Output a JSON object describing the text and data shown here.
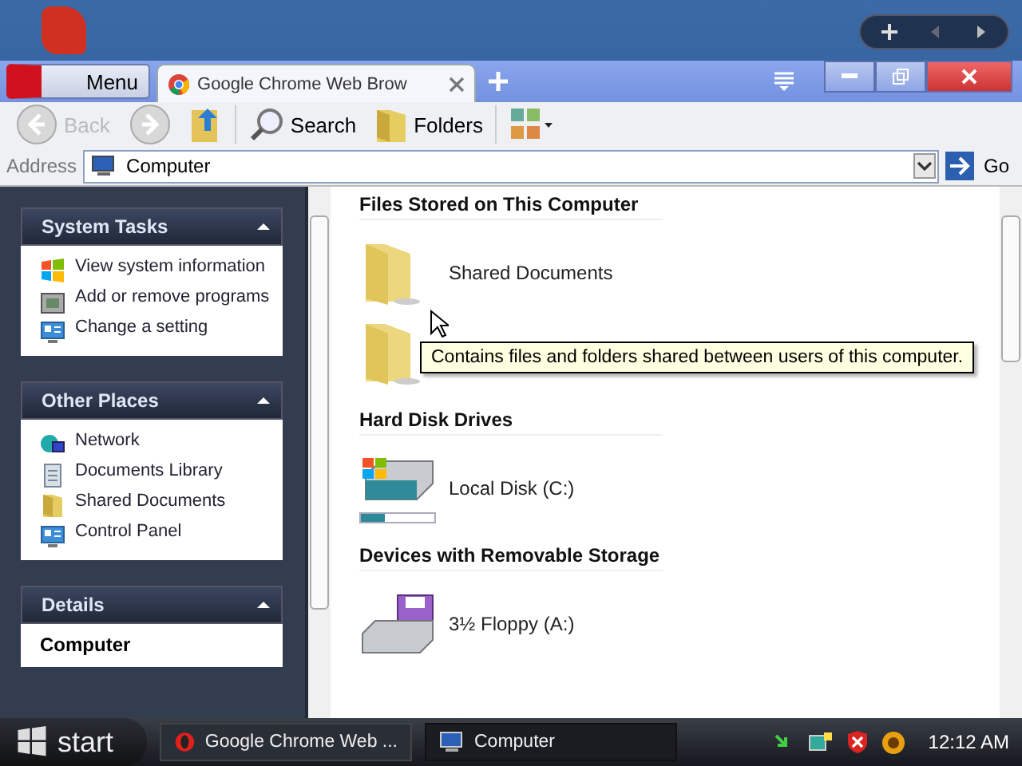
{
  "browser": {
    "menu_label": "Menu",
    "tabs": [
      {
        "label": "Google Chrome Web Brow",
        "selected": true
      }
    ]
  },
  "toolbar": {
    "buttons": [
      {
        "kind": "back",
        "label": "Back",
        "disabled": true
      },
      {
        "kind": "forward",
        "disabled": true
      },
      {
        "kind": "up"
      },
      {
        "kind": "search",
        "label": "Search"
      },
      {
        "kind": "folders",
        "label": "Folders"
      },
      {
        "kind": "views"
      }
    ]
  },
  "address": {
    "label": "Address",
    "value": "Computer",
    "go": "Go"
  },
  "sidebar": {
    "groups": [
      {
        "title": "System Tasks",
        "expanded": true,
        "items": [
          {
            "label": "View system information"
          },
          {
            "label": "Add or remove programs"
          },
          {
            "label": "Change a setting"
          }
        ]
      },
      {
        "title": "Other Places",
        "expanded": true,
        "items": [
          {
            "label": "Network"
          },
          {
            "label": "Documents Library"
          },
          {
            "label": "Shared Documents"
          },
          {
            "label": "Control Panel"
          }
        ]
      },
      {
        "title": "Details",
        "expanded": true,
        "items": [
          {
            "label": "Computer"
          }
        ]
      }
    ]
  },
  "sections": [
    {
      "title": "Files Stored on This Computer",
      "items": [
        {
          "kind": "folder",
          "label": "Shared Documents"
        },
        {
          "kind": "folder"
        }
      ]
    },
    {
      "title": "Hard Disk Drives",
      "items": [
        {
          "kind": "disk",
          "label": "Local Disk (C:)",
          "level": 0.33
        }
      ]
    },
    {
      "title": "Devices with Removable Storage",
      "items": [
        {
          "kind": "floppy",
          "label": "3½ Floppy (A:)"
        }
      ]
    }
  ],
  "tooltip": "Contains files and folders shared between users of this computer.",
  "taskbar": {
    "start": "start",
    "tasks": [
      {
        "label": "Google Chrome Web ...",
        "selected": false
      },
      {
        "label": "Computer",
        "selected": true
      }
    ],
    "time": "12:12 AM"
  }
}
